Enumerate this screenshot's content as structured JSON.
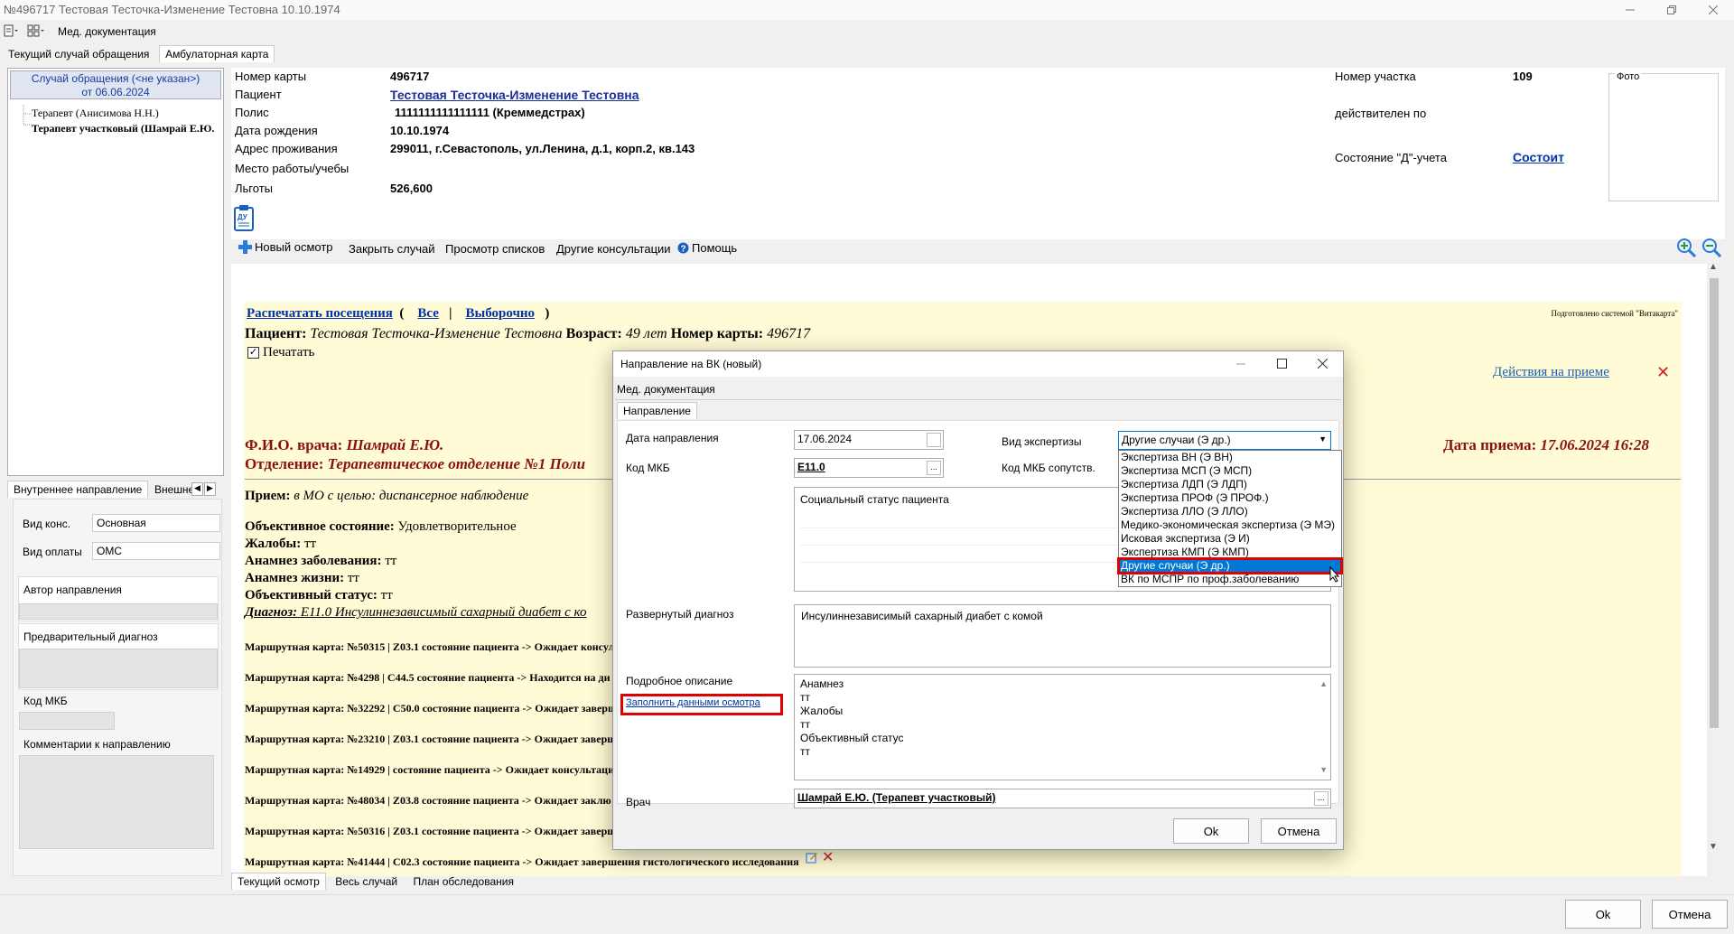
{
  "window": {
    "title": "№496717 Тестовая Тесточка-Изменение Тестовна 10.10.1974"
  },
  "toolbar": {
    "med_docs_label": "Мед. документация"
  },
  "top_tabs": [
    {
      "label": "Текущий случай обращения"
    },
    {
      "label": "Амбулаторная карта"
    }
  ],
  "left": {
    "case_header_line1": "Случай обращения (<не указан>)",
    "case_header_line2": "от 06.06.2024",
    "tree": [
      "Терапевт (Анисимова Н.Н.)",
      "Терапевт участковый (Шамрай Е.Ю."
    ],
    "subtabs": [
      "Внутреннее направление",
      "Внешне"
    ],
    "vid_kons_label": "Вид конс.",
    "vid_kons_value": "Основная",
    "vid_oplaty_label": "Вид оплаты",
    "vid_oplaty_value": "ОМС",
    "avtor_label": "Автор направления",
    "pred_diag_label": "Предварительный диагноз",
    "kod_mkb_label": "Код МКБ",
    "comments_label": "Комментарии к направлению"
  },
  "patient": {
    "card_label": "Номер карты",
    "card_value": "496717",
    "patient_label": "Пациент",
    "patient_value": "Тестовая Тесточка-Изменение Тестовна",
    "polis_label": "Полис",
    "polis_value": "1111111111111111 (Креммедстрах)",
    "dob_label": "Дата рождения",
    "dob_value": "10.10.1974",
    "address_label": "Адрес проживания",
    "address_value": "299011, г.Севастополь, ул.Ленина, д.1, корп.2, кв.143",
    "work_label": "Место работы/учебы",
    "benefits_label": "Льготы",
    "benefits_value": "526,600",
    "uchastok_label": "Номер участка",
    "uchastok_value": "109",
    "valid_label": "действителен по",
    "d_label": "Состояние \"Д\"-учета",
    "d_value": "Состоит",
    "photo_label": "Фото"
  },
  "actions": {
    "new_exam": "Новый осмотр",
    "close_case": "Закрыть случай",
    "view_lists": "Просмотр списков",
    "other_consult": "Другие консультации",
    "help": "Помощь"
  },
  "doc": {
    "print_visits": "Распечатать посещения",
    "all": "Все",
    "selective": "Выборочно",
    "prepared_by": "Подготовлено системой \"Витакарта\"",
    "patient_label": "Пациент:",
    "patient_name": "Тестовая Тесточка-Изменение Тестовна",
    "age_label": "Возраст:",
    "age_value": "49 лет",
    "card_label": "Номер карты:",
    "card_value": "496717",
    "print_label": "Печатать",
    "actions_link": "Действия на приеме",
    "doctor_label": "Ф.И.О. врача:",
    "doctor_value": "Шамрай Е.Ю.",
    "dept_label": "Отделение:",
    "dept_value": "Терапевтическое отделение №1 Поли",
    "date_label": "Дата приема:",
    "date_value": "17.06.2024 16:28",
    "priem_label": "Прием:",
    "priem_value": "в МО с целью:",
    "priem_goal": "диспансерное наблюдение",
    "obj_label": "Объективное состояние:",
    "obj_value": "Удовлетворительное",
    "complaints_label": "Жалобы:",
    "complaints_value": "тт",
    "anamnez_z_label": "Анамнез заболевания:",
    "anamnez_z_value": "тт",
    "anamnez_l_label": "Анамнез жизни:",
    "anamnez_l_value": "тт",
    "obj_status_label": "Объективный статус:",
    "obj_status_value": "тт",
    "diag_label": "Диагноз:",
    "diag_value": "E11.0 Инсулиннезависимый сахарный диабет с ко",
    "routes": [
      "Маршрутная карта: №50315 | Z03.1 состояние пациента -> Ожидает консул",
      "Маршрутная карта: №4298 | C44.5 состояние пациента -> Находится на ди",
      "Маршрутная карта: №32292 | C50.0 состояние пациента -> Ожидает заверш",
      "Маршрутная карта: №23210 | Z03.1 состояние пациента -> Ожидает заверш",
      "Маршрутная карта: №14929 | состояние пациента -> Ожидает консультаци",
      "Маршрутная карта: №48034 | Z03.8 состояние пациента -> Ожидает заклю",
      "Маршрутная карта: №50316 | Z03.1 состояние пациента -> Ожидает заверш",
      "Маршрутная карта: №41444 | C02.3 состояние пациента -> Ожидает завершения гистологического исследования"
    ]
  },
  "bottom_tabs": [
    "Текущий осмотр",
    "Весь случай",
    "План обследования"
  ],
  "footer": {
    "ok": "Ok",
    "cancel": "Отмена"
  },
  "dialog": {
    "title": "Направление на ВК (новый)",
    "menu": "Мед. документация",
    "tab": "Направление",
    "date_label": "Дата направления",
    "date_value": "17.06.2024",
    "expertise_label": "Вид экспертизы",
    "expertise_value": "Другие случаи (Э др.)",
    "mkb_label": "Код МКБ",
    "mkb_value": "E11.0",
    "mkb_sub_label": "Код МКБ сопутств.",
    "social_status": "Социальный статус пациента",
    "diag_label": "Развернутый диагноз",
    "diag_value": "Инсулиннезависимый сахарный диабет с комой",
    "desc_label": "Подробное описание",
    "fill_link": "Заполнить данными осмотра",
    "desc_lines": [
      "Анамнез",
      "тт",
      "Жалобы",
      "тт",
      "Объективный статус",
      "тт"
    ],
    "doctor_label": "Врач",
    "doctor_value": "Шамрай Е.Ю. (Терапевт участковый)",
    "ok": "Ok",
    "cancel": "Отмена",
    "options": [
      "Экспертиза ВН (Э ВН)",
      "Экспертиза МСП (Э МСП)",
      "Экспертиза ЛДП (Э ЛДП)",
      "Экспертиза ПРОФ (Э ПРОФ.)",
      "Экспертиза ЛЛО (Э ЛЛО)",
      "Медико-экономическая экспертиза (Э МЭ)",
      "Исковая экспертиза (Э И)",
      "Экспертиза КМП (Э КМП)",
      "Другие случаи (Э др.)",
      "ВК по МСПР по проф.заболеванию"
    ],
    "selected_index": 8
  }
}
